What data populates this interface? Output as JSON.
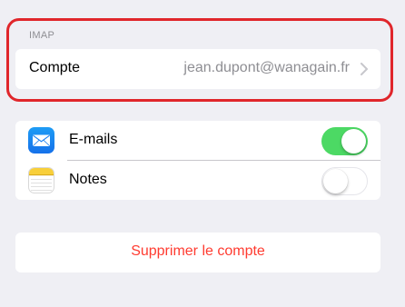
{
  "account_section": {
    "header": "IMAP",
    "row_label": "Compte",
    "row_value": "jean.dupont@wanagain.fr"
  },
  "services": [
    {
      "label": "E-mails",
      "icon": "mail-icon",
      "enabled": true
    },
    {
      "label": "Notes",
      "icon": "notes-icon",
      "enabled": false
    }
  ],
  "delete_button": {
    "label": "Supprimer le compte"
  },
  "colors": {
    "background": "#efeff4",
    "toggle_on": "#4cd964",
    "destructive": "#ff3b30",
    "highlight_outline": "#e0262b",
    "secondary_text": "#8e8e93"
  }
}
